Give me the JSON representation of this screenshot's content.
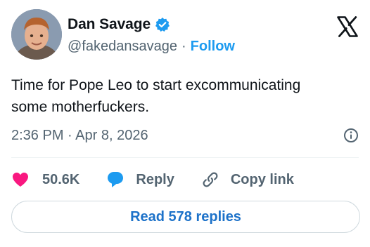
{
  "author": {
    "display_name": "Dan Savage",
    "handle": "@fakedansavage",
    "separator": "·",
    "follow_label": "Follow",
    "verified_color": "#1d9bf0"
  },
  "tweet": {
    "text": "Time for Pope Leo to start excommunicating\nsome motherfuckers.",
    "timestamp": "2:36 PM · Apr 8, 2026"
  },
  "actions": {
    "like_count": "50.6K",
    "like_color": "#f91880",
    "reply_label": "Reply",
    "reply_color": "#1d9bf0",
    "copy_link_label": "Copy link"
  },
  "read_replies_label": "Read 578 replies",
  "icons": {
    "logo": "x-logo-icon",
    "verified": "verified-badge-icon",
    "info": "info-icon",
    "like": "heart-icon",
    "reply": "speech-bubble-icon",
    "copy": "link-icon"
  }
}
